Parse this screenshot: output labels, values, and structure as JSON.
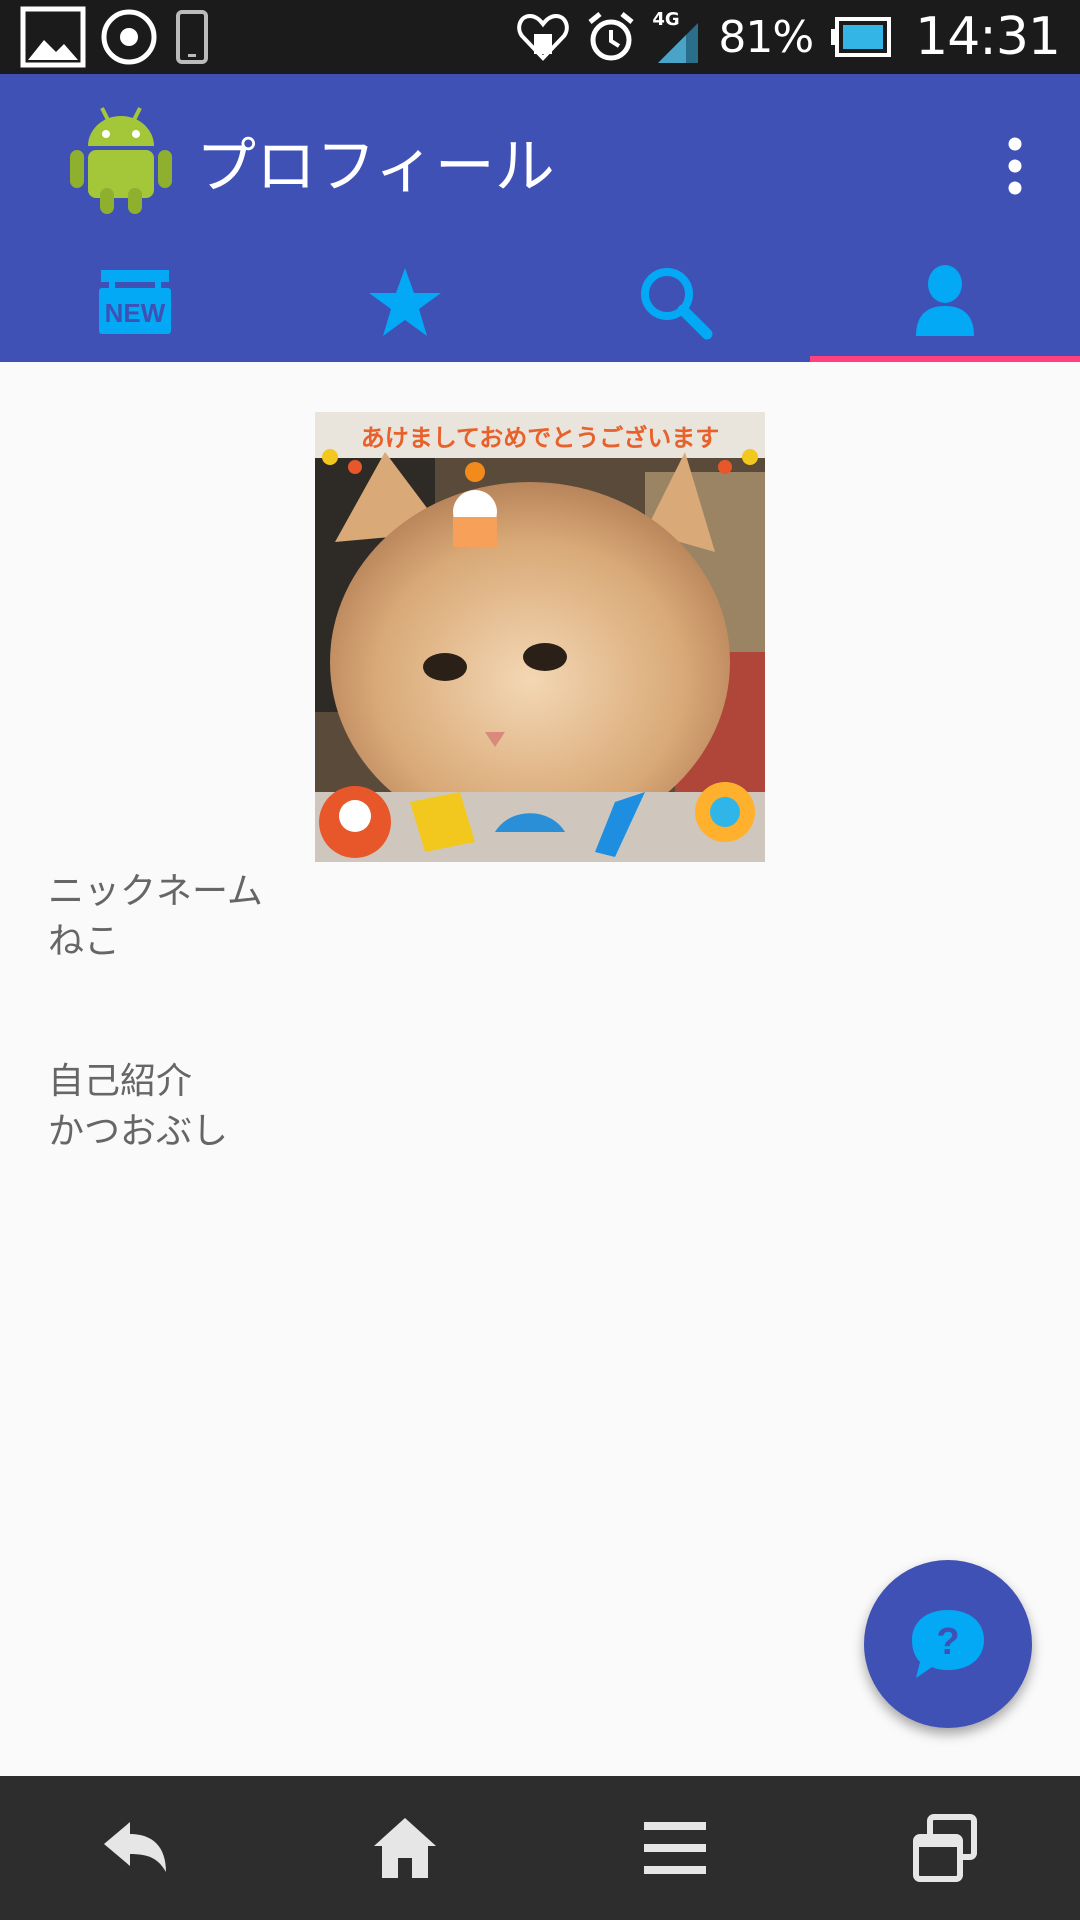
{
  "status_bar": {
    "battery": "81%",
    "time": "14:31",
    "network": "4G",
    "icons": [
      "gallery-icon",
      "record-icon",
      "phone-device-icon",
      "health-heart-icon",
      "alarm-icon",
      "signal-icon",
      "battery-icon"
    ]
  },
  "app_bar": {
    "title": "プロフィール",
    "logo": "android-robot-icon",
    "menu_icon": "overflow-menu-icon",
    "colors": {
      "primary": "#3f51b5",
      "tab_icon": "#03a9f4",
      "indicator": "#ff4081"
    }
  },
  "tabs": [
    {
      "icon": "new-badge-icon",
      "label": "NEW",
      "selected": false
    },
    {
      "icon": "star-icon",
      "selected": false
    },
    {
      "icon": "search-icon",
      "selected": false
    },
    {
      "icon": "person-icon",
      "selected": true
    }
  ],
  "profile": {
    "photo_caption": "あけましておめでとうございます",
    "fields": [
      {
        "label": "ニックネーム",
        "value": "ねこ"
      },
      {
        "label": "自己紹介",
        "value": "かつおぶし"
      }
    ]
  },
  "fab": {
    "icon": "help-chat-icon",
    "symbol": "?"
  },
  "nav_bar": {
    "buttons": [
      "back-icon",
      "home-icon",
      "menu-icon",
      "recents-icon"
    ]
  }
}
